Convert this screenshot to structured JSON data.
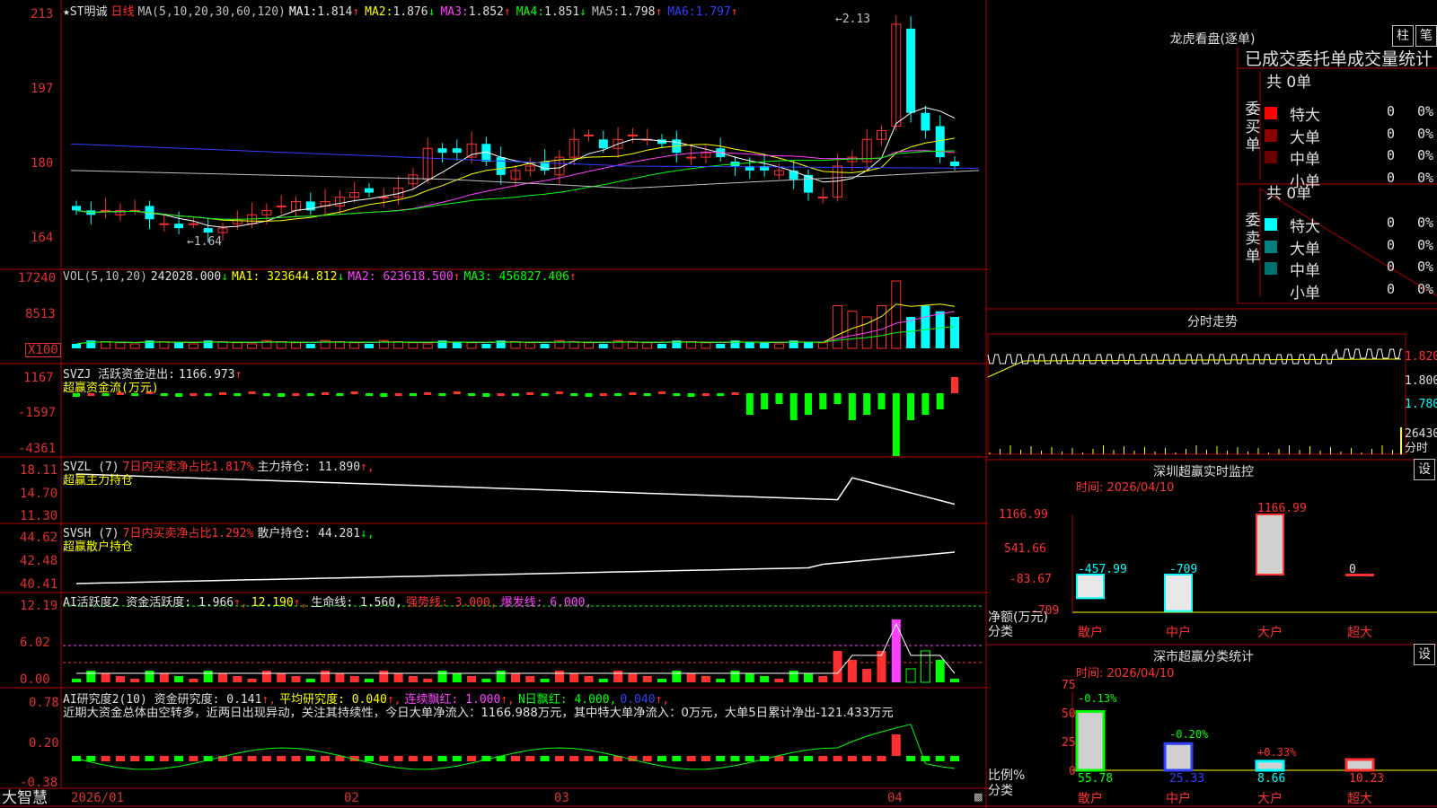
{
  "app": {
    "brand": "大智慧"
  },
  "header": {
    "star": "★",
    "stock": "ST明诚",
    "period": "日线",
    "ma_params": "MA(5,10,20,30,60,120)",
    "mas": [
      {
        "label": "MA1:",
        "value": "1.814",
        "arrow": "↑",
        "color": "#ffffff"
      },
      {
        "label": "MA2:",
        "value": "1.876",
        "arrow": "↓",
        "color": "#ffff00"
      },
      {
        "label": "MA3:",
        "value": "1.852",
        "arrow": "↑",
        "color": "#ff40ff"
      },
      {
        "label": "MA4:",
        "value": "1.851",
        "arrow": "↓",
        "color": "#00ff00"
      },
      {
        "label": "MA5:",
        "value": "1.798",
        "arrow": "↑",
        "color": "#c0c0c0"
      },
      {
        "label": "MA6:",
        "value": "1.797",
        "arrow": "↑",
        "color": "#3040ff"
      }
    ]
  },
  "price": {
    "max_label": "←2.13",
    "min_label": "←1.64",
    "ticks": [
      "213",
      "197",
      "180",
      "164"
    ]
  },
  "vol": {
    "title": "VOL(5,10,20)",
    "value": "242028.000",
    "arrow": "↓",
    "ma1": "MA1: 323644.812",
    "ma1_arrow": "↓",
    "ma2": "MA2: 623618.500",
    "ma2_arrow": "↑",
    "ma3": "MA3: 456827.406",
    "ma3_arrow": "↑",
    "ticks": [
      "17240",
      "8513",
      "X100"
    ]
  },
  "svzj": {
    "title": "SVZJ  活跃资金进出:",
    "value": "1166.973",
    "arrow": "↑",
    "subtitle": "超赢资金流(万元)",
    "ticks": [
      "1167",
      "-1597",
      "-4361"
    ]
  },
  "svzl": {
    "title": "SVZL (7)",
    "ratio": "7日内买卖净占比1.817%",
    "hold": "主力持仓: 11.890",
    "arrow": "↑,",
    "subtitle": "超赢主力持仓",
    "ticks": [
      "18.11",
      "14.70",
      "11.30"
    ]
  },
  "svsh": {
    "title": "SVSH (7)",
    "ratio": "7日内买卖净占比1.292%",
    "hold": "散户持仓: 44.281",
    "arrow": "↓,",
    "subtitle": "超赢散户持仓",
    "ticks": [
      "44.62",
      "42.48",
      "40.41"
    ]
  },
  "ai1": {
    "title": "AI活跃度2 资金活跃度: 1.966",
    "a1": "↑,",
    "v2": "12.190",
    "a2": "↑,",
    "life": "生命线: 1.560,",
    "strong": "强势线: 3.000,",
    "burst": "爆发线: 6.000,",
    "ticks": [
      "12.19",
      "6.02",
      "0.00"
    ]
  },
  "ai2": {
    "title": "AI研究度2(10) 资金研究度: 0.141",
    "a1": "↑,",
    "avg": "平均研究度: 0.040",
    "a2": "↑,",
    "streak": "连续飘红: 1.000",
    "a3": "↑,",
    "nday": "N日飘红: 4.000,",
    "nval": "0.040",
    "a4": "↑,",
    "comment": "近期大资金总体由空转多，近两日出现异动，关注其持续性，今日大单净流入：1166.988万元，其中特大单净流入：0万元，大单5日累计净出-121.433万元",
    "ticks": [
      "0.78",
      "0.20",
      "-0.38"
    ]
  },
  "xaxis": [
    "2026/01",
    "02",
    "03",
    "04"
  ],
  "dragon": {
    "title": "龙虎看盘(逐单)",
    "btn1": "柱",
    "btn2": "笔",
    "subtitle": "已成交委托单成交量统计",
    "buy": {
      "label": "委买单",
      "total": "共 0单",
      "rows": [
        {
          "name": "特大",
          "v": "0",
          "p": "0%",
          "color": "#ff0000"
        },
        {
          "name": "大单",
          "v": "0",
          "p": "0%",
          "color": "#8b0000"
        },
        {
          "name": "中单",
          "v": "0",
          "p": "0%",
          "color": "#6b0000"
        },
        {
          "name": "小单",
          "v": "0",
          "p": "0%",
          "color": ""
        }
      ]
    },
    "sell": {
      "label": "委卖单",
      "total": "共 0单",
      "rows": [
        {
          "name": "特大",
          "v": "0",
          "p": "0%",
          "color": "#00ffff"
        },
        {
          "name": "大单",
          "v": "0",
          "p": "0%",
          "color": "#008080"
        },
        {
          "name": "中单",
          "v": "0",
          "p": "0%",
          "color": "#007070"
        },
        {
          "name": "小单",
          "v": "0",
          "p": "0%",
          "color": ""
        }
      ]
    }
  },
  "intraday": {
    "title": "分时走势",
    "ticks": [
      "1.820",
      "1.800",
      "1.780"
    ],
    "vol": "26430",
    "vol_label": "分时"
  },
  "sz_monitor": {
    "title": "深圳超赢实时监控",
    "btn": "设",
    "time": "时间: 2026/04/10",
    "ticks": [
      "1166.99",
      "541.66",
      "-83.67",
      "-709"
    ],
    "axis_label": "净额(万元)",
    "cat_label": "分类",
    "categories": [
      "散户",
      "中户",
      "大户",
      "超大"
    ],
    "values": [
      -457.99,
      -709,
      1166.99,
      0
    ],
    "value_labels": [
      "-457.99",
      "-709",
      "1166.99",
      "0"
    ]
  },
  "sz_class": {
    "title": "深市超赢分类统计",
    "btn": "设",
    "time": "时间: 2026/04/10",
    "ticks": [
      "75",
      "50",
      "25",
      "0"
    ],
    "axis_label": "比例%",
    "cat_label": "分类",
    "categories": [
      "散户",
      "中户",
      "大户",
      "超大"
    ],
    "values": [
      55.78,
      25.33,
      8.66,
      10.23
    ],
    "value_labels": [
      "55.78",
      "25.33",
      "8.66",
      "10.23"
    ],
    "changes": [
      "-0.13%",
      "-0.20%",
      "+0.33%",
      ""
    ]
  },
  "colors": {
    "up": "#ff3030",
    "down": "#00ffff",
    "grid": "#b00000",
    "ma1": "#ffffff",
    "ma2": "#ffff00",
    "ma3": "#ff40ff",
    "ma4": "#00ff00",
    "ma5": "#c0c0c0",
    "ma6": "#3040ff"
  }
}
